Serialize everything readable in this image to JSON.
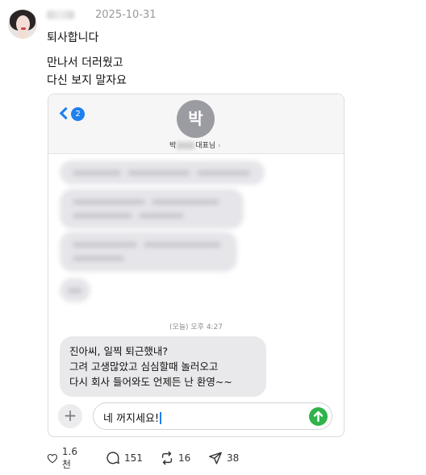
{
  "post": {
    "date": "2025-10-31",
    "line1": "퇴사합니다",
    "line2": "만나서 더러웠고",
    "line3": "다신 보지 말자요"
  },
  "chat": {
    "unread_count": "2",
    "contact_initial": "박",
    "contact_name_prefix": "박",
    "contact_name_suffix": "대표님",
    "contact_caret": "›",
    "timestamp": "(오늘) 오후 4:27",
    "incoming_lines": [
      "진아씨, 일찍 퇴근했내?",
      "그려 고생많았고 심심할때 놀러오고",
      "다시 회사 들어와도 언제든 난 환영~~"
    ],
    "input_text": "네 꺼지세요!",
    "accent_color": "#1d7ff0",
    "send_color": "#2fb34a"
  },
  "actions": {
    "likes": "1.6천",
    "replies": "151",
    "reposts": "16",
    "shares": "38"
  }
}
